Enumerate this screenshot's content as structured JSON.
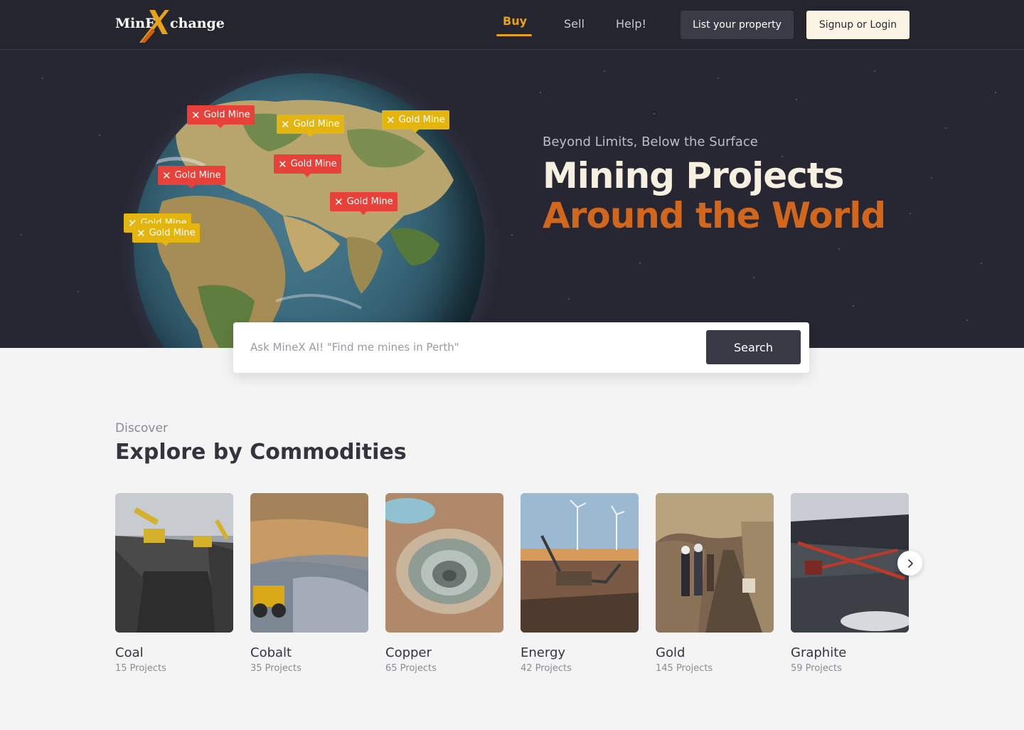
{
  "nav": {
    "logo_left": "MinE",
    "logo_right": "change",
    "links": [
      {
        "label": "Buy"
      },
      {
        "label": "Sell"
      },
      {
        "label": "Help!"
      }
    ],
    "list_property": "List your property",
    "signup_login": "Signup or Login",
    "active_color": "#e8a11a"
  },
  "hero": {
    "tagline": "Beyond Limits, Below the Surface",
    "headline_line1": "Mining Projects",
    "headline_line2": "Around the World",
    "accent_color": "#d2671c",
    "pins": [
      {
        "label": "Gold Mine",
        "color": "red"
      },
      {
        "label": "Gold Mine",
        "color": "yellow"
      },
      {
        "label": "Gold Mine",
        "color": "yellow"
      },
      {
        "label": "Gold Mine",
        "color": "red"
      },
      {
        "label": "Gold Mine",
        "color": "red"
      },
      {
        "label": "Gold Mine",
        "color": "red"
      },
      {
        "label": "Gold Mine",
        "color": "yellow"
      },
      {
        "label": "Gold Mine",
        "color": "yellow"
      }
    ]
  },
  "search": {
    "placeholder": "Ask MineX AI! \"Find me mines in Perth\"",
    "button": "Search"
  },
  "discover": {
    "label": "Discover",
    "title": "Explore by Commodities",
    "commodities": [
      {
        "name": "Coal",
        "count": "15 Projects"
      },
      {
        "name": "Cobalt",
        "count": "35 Projects"
      },
      {
        "name": "Copper",
        "count": "65 Projects"
      },
      {
        "name": "Energy",
        "count": "42 Projects"
      },
      {
        "name": "Gold",
        "count": "145 Projects"
      },
      {
        "name": "Graphite",
        "count": "59 Projects"
      }
    ],
    "next_icon": "chevron-right-icon"
  }
}
